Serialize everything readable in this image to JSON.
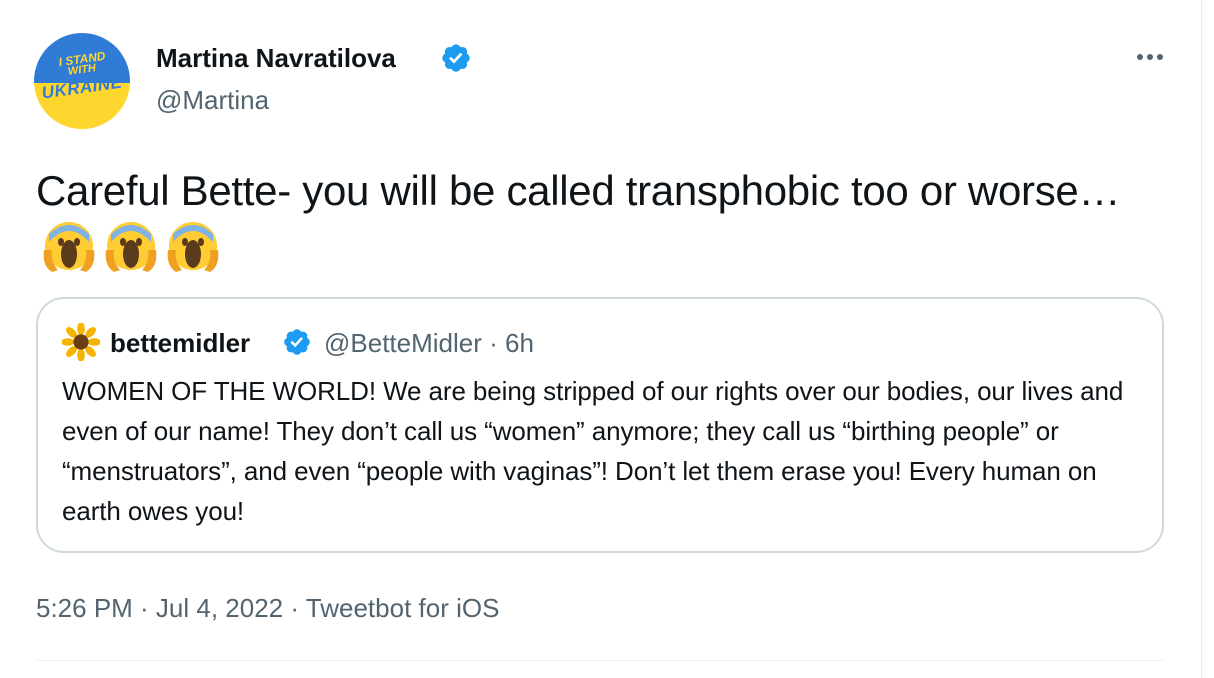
{
  "tweet": {
    "avatar_text": [
      "I STAND",
      "WITH",
      "UKRAINE"
    ],
    "author_name": "Martina Navratilova",
    "author_handle": "@Martina",
    "text": "Careful Bette- you will be called transphobic too or worse…",
    "emojis": [
      "face-screaming-in-fear",
      "face-screaming-in-fear",
      "face-screaming-in-fear"
    ],
    "timestamp": "5:26 PM · Jul 4, 2022 · Tweetbot for iOS"
  },
  "quoted_tweet": {
    "avatar_icon": "sunflower-icon",
    "author_name": "bettemidler",
    "meta": "@BetteMidler · 6h",
    "text": "WOMEN OF THE WORLD! We are being stripped of our rights over our bodies, our lives and even of our name! They don’t call us “women” anymore; they call us “birthing people” or “menstruators”, and even “people with vaginas”!  Don’t let them erase you! Every human on earth owes you!"
  },
  "colors": {
    "text_primary": "#0f1419",
    "text_secondary": "#536471",
    "verified_blue": "#1d9bf0",
    "border": "#cfd9de",
    "ukraine_blue": "#2f7bd6",
    "ukraine_yellow": "#ffd62e"
  }
}
